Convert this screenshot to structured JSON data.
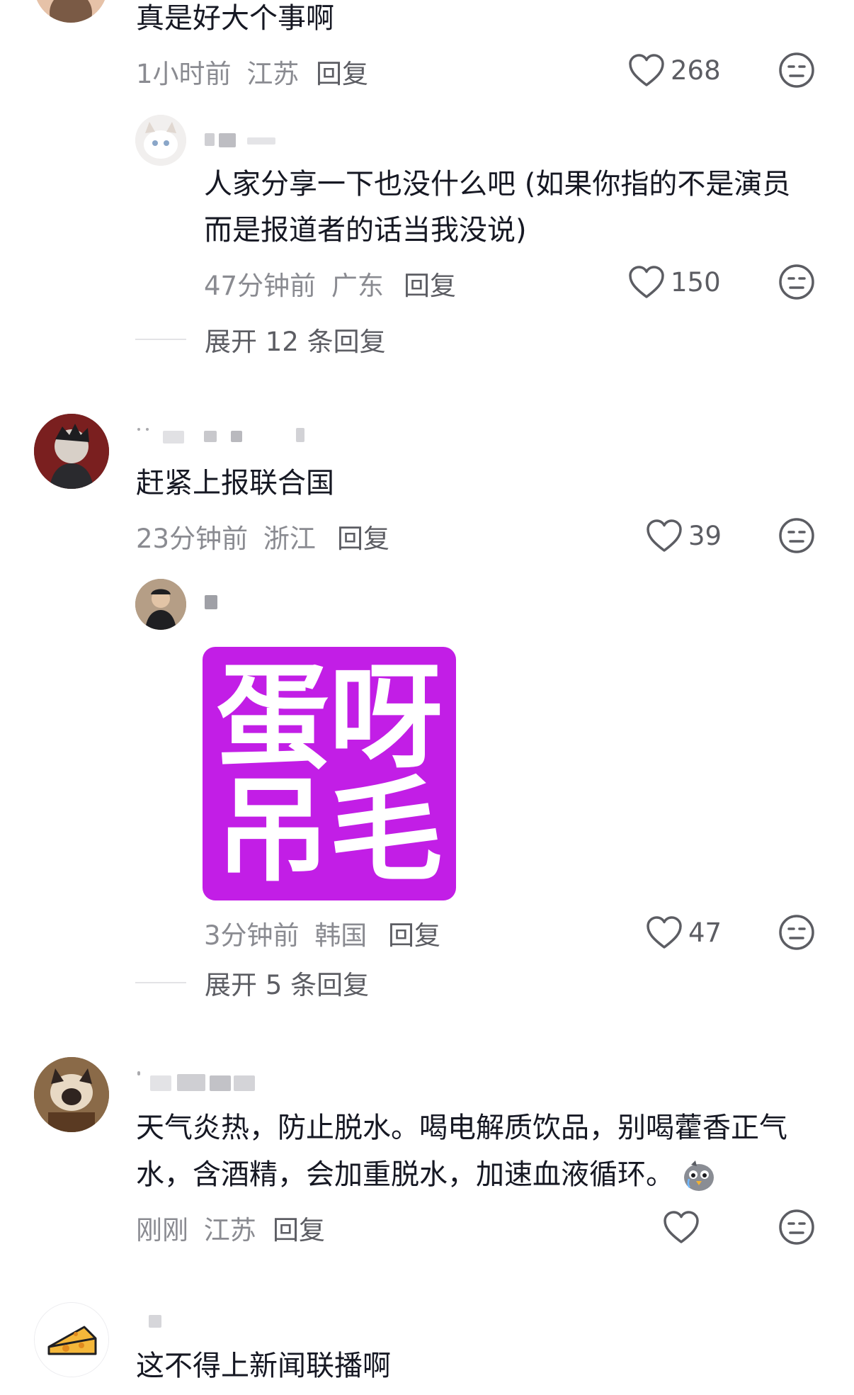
{
  "comments": [
    {
      "text": "真是好大个事啊",
      "time": "1小时前",
      "location": "江苏",
      "reply_label": "回复",
      "likes": "268"
    },
    {
      "text_line1": "人家分享一下也没什么吧 (如果你指的不是演员",
      "text_line2": "而是报道者的话当我没说)",
      "time": "47分钟前",
      "location": "广东",
      "reply_label": "回复",
      "likes": "150",
      "expand_label": "展开 12 条回复"
    },
    {
      "text": "赶紧上报联合国",
      "time": "23分钟前",
      "location": "浙江",
      "reply_label": "回复",
      "likes": "39"
    },
    {
      "sticker_chars": [
        "蛋",
        "呀",
        "吊",
        "毛"
      ],
      "time": "3分钟前",
      "location": "韩国",
      "reply_label": "回复",
      "likes": "47",
      "expand_label": "展开 5 条回复"
    },
    {
      "text_line1": "天气炎热，防止脱水。喝电解质饮品，别喝藿香正气",
      "text_line2": "水，含酒精，会加重脱水，加速血液循环。",
      "time": "刚刚",
      "location": "江苏",
      "reply_label": "回复",
      "likes": ""
    },
    {
      "text": "这不得上新闻联播啊"
    }
  ],
  "colors": {
    "sticker_bg": "#c21ee6",
    "text_primary": "#161823",
    "text_secondary": "#8a8b91"
  }
}
